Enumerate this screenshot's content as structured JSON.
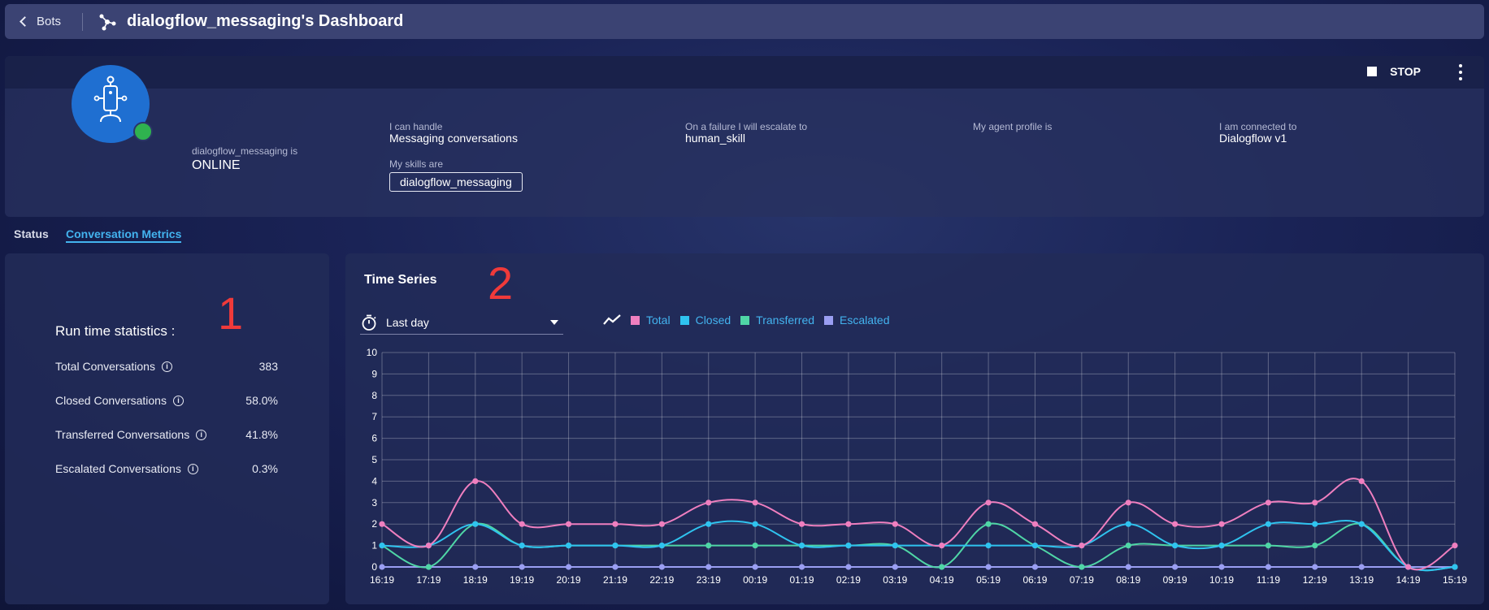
{
  "topbar": {
    "back_label": "Bots",
    "title": "dialogflow_messaging's Dashboard"
  },
  "bot": {
    "status_label": "dialogflow_messaging is",
    "status_value": "ONLINE",
    "handle_label": "I can handle",
    "handle_value": "Messaging conversations",
    "skills_label": "My skills are",
    "skill": "dialogflow_messaging",
    "escalate_label": "On a failure I will escalate to",
    "escalate_value": "human_skill",
    "agent_label": "My agent profile is",
    "connected_label": "I am connected to",
    "connected_value": "Dialogflow v1",
    "stop_label": "STOP",
    "status_color": "#2fb24f"
  },
  "tabs": [
    {
      "label": "Status"
    },
    {
      "label": "Conversation Metrics",
      "active": true
    }
  ],
  "annotations": [
    "1",
    "2"
  ],
  "stats": {
    "title": "Run time statistics :",
    "rows": [
      {
        "label": "Total Conversations",
        "value": "383"
      },
      {
        "label": "Closed Conversations",
        "value": "58.0%"
      },
      {
        "label": "Transferred Conversations",
        "value": "41.8%"
      },
      {
        "label": "Escalated Conversations",
        "value": "0.3%"
      }
    ]
  },
  "timeseries": {
    "title": "Time Series",
    "range": "Last day"
  },
  "chart_data": {
    "type": "line",
    "x": [
      "16:19",
      "17:19",
      "18:19",
      "19:19",
      "20:19",
      "21:19",
      "22:19",
      "23:19",
      "00:19",
      "01:19",
      "02:19",
      "03:19",
      "04:19",
      "05:19",
      "06:19",
      "07:19",
      "08:19",
      "09:19",
      "10:19",
      "11:19",
      "12:19",
      "13:19",
      "14:19",
      "15:19"
    ],
    "ylim": [
      0,
      10
    ],
    "yticks": [
      0,
      1,
      2,
      3,
      4,
      5,
      6,
      7,
      8,
      9,
      10
    ],
    "grid": true,
    "legend_position": "top",
    "series": [
      {
        "name": "Total",
        "color": "#ef7fbf",
        "values": [
          2,
          1,
          4,
          2,
          2,
          2,
          2,
          3,
          3,
          2,
          2,
          2,
          1,
          3,
          2,
          1,
          3,
          2,
          2,
          3,
          3,
          4,
          0,
          1
        ]
      },
      {
        "name": "Closed",
        "color": "#2fc3ef",
        "values": [
          1,
          1,
          2,
          1,
          1,
          1,
          1,
          2,
          2,
          1,
          1,
          1,
          1,
          1,
          1,
          1,
          2,
          1,
          1,
          2,
          2,
          2,
          0,
          0
        ]
      },
      {
        "name": "Transferred",
        "color": "#4fd6a6",
        "values": [
          1,
          0,
          2,
          1,
          1,
          1,
          1,
          1,
          1,
          1,
          1,
          1,
          0,
          2,
          1,
          0,
          1,
          1,
          1,
          1,
          1,
          2,
          0,
          0
        ]
      },
      {
        "name": "Escalated",
        "color": "#9a9ef2",
        "values": [
          0,
          0,
          0,
          0,
          0,
          0,
          0,
          0,
          0,
          0,
          0,
          0,
          0,
          0,
          0,
          0,
          0,
          0,
          0,
          0,
          0,
          0,
          0,
          0
        ]
      }
    ]
  }
}
